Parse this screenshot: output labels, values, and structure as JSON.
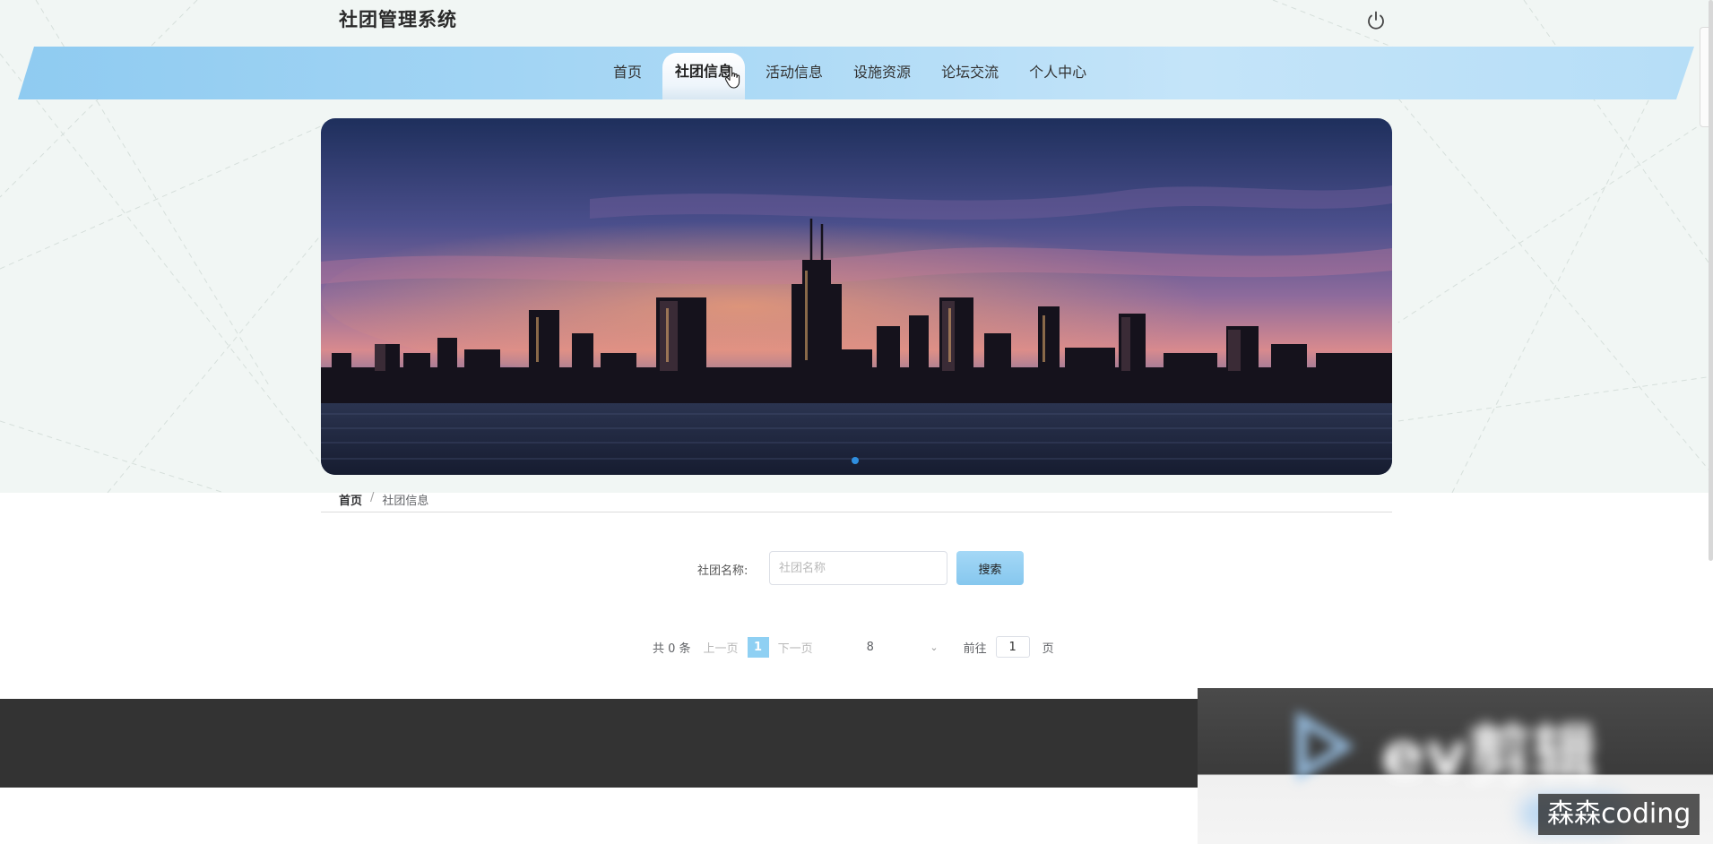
{
  "header": {
    "app_title": "社团管理系统"
  },
  "nav": {
    "items": [
      {
        "label": "首页"
      },
      {
        "label": "社团信息",
        "active": true
      },
      {
        "label": "活动信息"
      },
      {
        "label": "设施资源"
      },
      {
        "label": "论坛交流"
      },
      {
        "label": "个人中心"
      }
    ]
  },
  "banner": {
    "slide_count": 1,
    "active_slide": 1
  },
  "breadcrumb": {
    "home": "首页",
    "separator": "/",
    "current": "社团信息"
  },
  "search": {
    "label": "社团名称:",
    "placeholder": "社团名称",
    "value": "",
    "button_label": "搜索"
  },
  "pagination": {
    "total_text": "共 0 条",
    "prev_label": "上一页",
    "current_page": "1",
    "next_label": "下一页",
    "page_size": "8",
    "goto_label": "前往",
    "goto_value": "1",
    "page_unit": "页"
  },
  "watermark": {
    "logo_text": "ev剪辑",
    "label": "森森coding"
  },
  "colors": {
    "nav_band": "#a9d8f5",
    "active_page": "#8fd0f3",
    "search_button": "#93cdf1",
    "footer": "#333333",
    "banner_dot": "#2f8fe0"
  }
}
